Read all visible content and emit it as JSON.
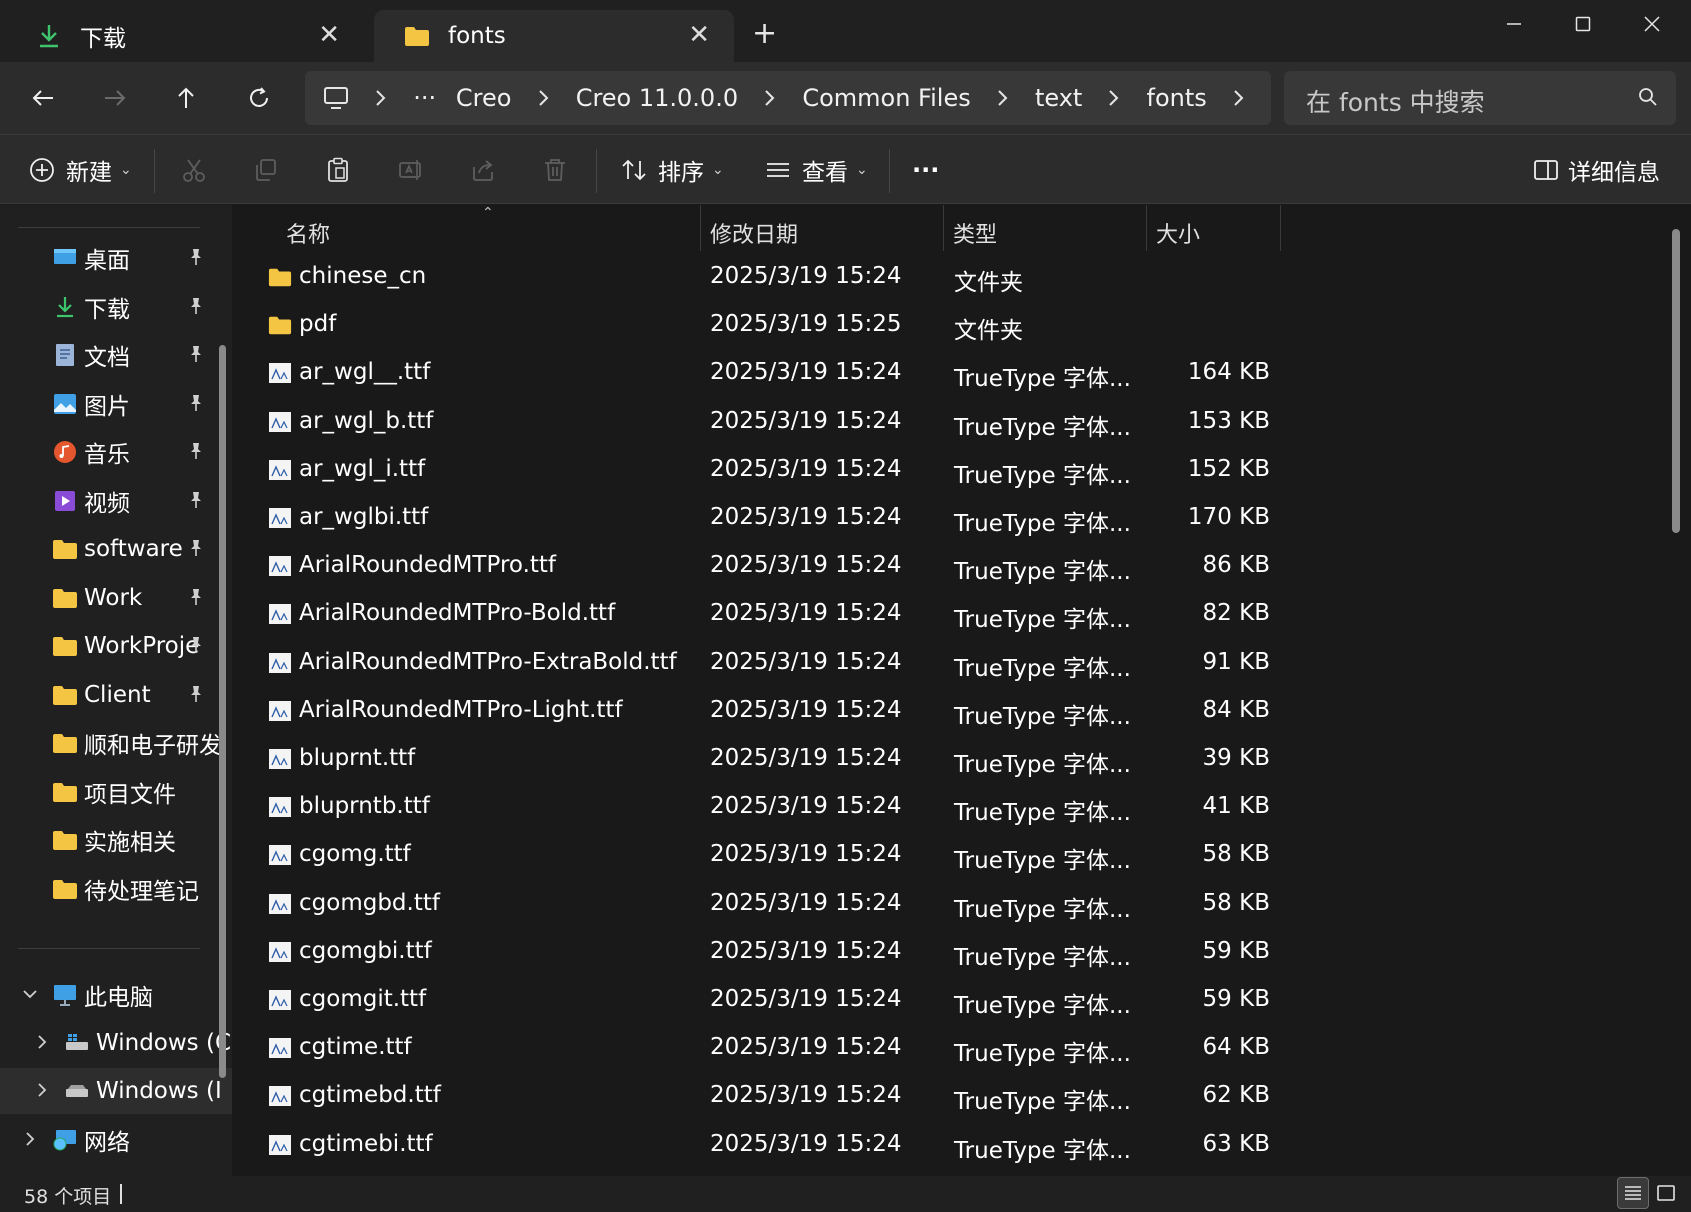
{
  "tabs": [
    {
      "label": "下载",
      "icon": "download-arrow-icon"
    },
    {
      "label": "fonts",
      "icon": "folder-icon"
    }
  ],
  "new_tab_label": "+",
  "breadcrumb": [
    "Creo",
    "Creo 11.0.0.0",
    "Common Files",
    "text",
    "fonts"
  ],
  "search": {
    "placeholder": "在 fonts 中搜索"
  },
  "toolbar": {
    "new_label": "新建",
    "sort_label": "排序",
    "view_label": "查看",
    "more_label": "···",
    "details_label": "详细信息"
  },
  "sidebar": {
    "quick_access": [
      {
        "label": "桌面",
        "icon": "desktop-icon",
        "pinned": true
      },
      {
        "label": "下载",
        "icon": "download-arrow-icon",
        "pinned": true
      },
      {
        "label": "文档",
        "icon": "document-icon",
        "pinned": true
      },
      {
        "label": "图片",
        "icon": "pictures-icon",
        "pinned": true
      },
      {
        "label": "音乐",
        "icon": "music-icon",
        "pinned": true
      },
      {
        "label": "视频",
        "icon": "video-icon",
        "pinned": true
      },
      {
        "label": "software",
        "icon": "folder-icon",
        "pinned": true
      },
      {
        "label": "Work",
        "icon": "folder-icon",
        "pinned": true
      },
      {
        "label": "WorkProje",
        "icon": "folder-icon",
        "pinned": true
      },
      {
        "label": "Client",
        "icon": "folder-icon",
        "pinned": true
      },
      {
        "label": "顺和电子研发",
        "icon": "folder-icon",
        "pinned": false
      },
      {
        "label": "项目文件",
        "icon": "folder-icon",
        "pinned": false
      },
      {
        "label": "实施相关",
        "icon": "folder-icon",
        "pinned": false
      },
      {
        "label": "待处理笔记",
        "icon": "folder-icon",
        "pinned": false
      }
    ],
    "this_pc": {
      "label": "此电脑",
      "icon": "computer-icon"
    },
    "drives": [
      {
        "label": "Windows (C",
        "icon": "windows-drive-icon"
      },
      {
        "label": "Windows (I",
        "icon": "drive-icon"
      }
    ],
    "network": {
      "label": "网络",
      "icon": "network-icon"
    }
  },
  "columns": {
    "name": "名称",
    "date": "修改日期",
    "type": "类型",
    "size": "大小"
  },
  "files": [
    {
      "name": "chinese_cn",
      "date": "2025/3/19 15:24",
      "type": "文件夹",
      "size": "",
      "kind": "folder"
    },
    {
      "name": "pdf",
      "date": "2025/3/19 15:25",
      "type": "文件夹",
      "size": "",
      "kind": "folder"
    },
    {
      "name": "ar_wgl__.ttf",
      "date": "2025/3/19 15:24",
      "type": "TrueType 字体...",
      "size": "164 KB",
      "kind": "font"
    },
    {
      "name": "ar_wgl_b.ttf",
      "date": "2025/3/19 15:24",
      "type": "TrueType 字体...",
      "size": "153 KB",
      "kind": "font"
    },
    {
      "name": "ar_wgl_i.ttf",
      "date": "2025/3/19 15:24",
      "type": "TrueType 字体...",
      "size": "152 KB",
      "kind": "font"
    },
    {
      "name": "ar_wglbi.ttf",
      "date": "2025/3/19 15:24",
      "type": "TrueType 字体...",
      "size": "170 KB",
      "kind": "font"
    },
    {
      "name": "ArialRoundedMTPro.ttf",
      "date": "2025/3/19 15:24",
      "type": "TrueType 字体...",
      "size": "86 KB",
      "kind": "font"
    },
    {
      "name": "ArialRoundedMTPro-Bold.ttf",
      "date": "2025/3/19 15:24",
      "type": "TrueType 字体...",
      "size": "82 KB",
      "kind": "font"
    },
    {
      "name": "ArialRoundedMTPro-ExtraBold.ttf",
      "date": "2025/3/19 15:24",
      "type": "TrueType 字体...",
      "size": "91 KB",
      "kind": "font"
    },
    {
      "name": "ArialRoundedMTPro-Light.ttf",
      "date": "2025/3/19 15:24",
      "type": "TrueType 字体...",
      "size": "84 KB",
      "kind": "font"
    },
    {
      "name": "bluprnt.ttf",
      "date": "2025/3/19 15:24",
      "type": "TrueType 字体...",
      "size": "39 KB",
      "kind": "font"
    },
    {
      "name": "bluprntb.ttf",
      "date": "2025/3/19 15:24",
      "type": "TrueType 字体...",
      "size": "41 KB",
      "kind": "font"
    },
    {
      "name": "cgomg.ttf",
      "date": "2025/3/19 15:24",
      "type": "TrueType 字体...",
      "size": "58 KB",
      "kind": "font"
    },
    {
      "name": "cgomgbd.ttf",
      "date": "2025/3/19 15:24",
      "type": "TrueType 字体...",
      "size": "58 KB",
      "kind": "font"
    },
    {
      "name": "cgomgbi.ttf",
      "date": "2025/3/19 15:24",
      "type": "TrueType 字体...",
      "size": "59 KB",
      "kind": "font"
    },
    {
      "name": "cgomgit.ttf",
      "date": "2025/3/19 15:24",
      "type": "TrueType 字体...",
      "size": "59 KB",
      "kind": "font"
    },
    {
      "name": "cgtime.ttf",
      "date": "2025/3/19 15:24",
      "type": "TrueType 字体...",
      "size": "64 KB",
      "kind": "font"
    },
    {
      "name": "cgtimebd.ttf",
      "date": "2025/3/19 15:24",
      "type": "TrueType 字体...",
      "size": "62 KB",
      "kind": "font"
    },
    {
      "name": "cgtimebi.ttf",
      "date": "2025/3/19 15:24",
      "type": "TrueType 字体...",
      "size": "63 KB",
      "kind": "font"
    }
  ],
  "status": {
    "item_count": "58 个项目"
  },
  "colors": {
    "folder": "#f4c542",
    "accent": "#4cc2ff",
    "download": "#3ec46d"
  }
}
